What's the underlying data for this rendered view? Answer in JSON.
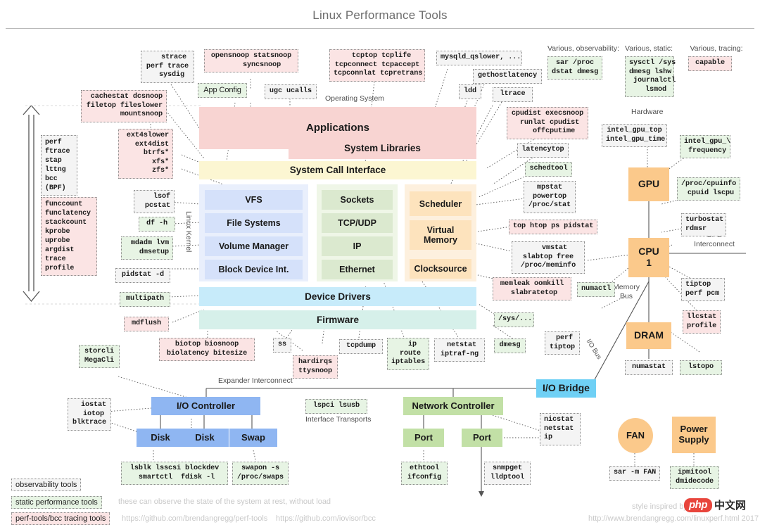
{
  "header": {
    "title": "Linux Performance Tools"
  },
  "section_labels": {
    "operating_system": "Operating System",
    "hardware": "Hardware",
    "linux_kernel": "Linux Kernel",
    "various_observability": "Various, observability:",
    "various_static": "Various, static:",
    "various_tracing": "Various, tracing:",
    "cpu_interconnect": "CPU\nInterconnect",
    "memory_bus": "Memory\nBus",
    "io_bus": "I/O Bus",
    "expander_interconnect": "Expander Interconnect",
    "interface_transports": "Interface Transports"
  },
  "stack": {
    "applications": "Applications",
    "system_libraries": "System Libraries",
    "system_call_interface": "System Call Interface",
    "device_drivers": "Device Drivers",
    "firmware": "Firmware",
    "file_column": [
      "VFS",
      "File Systems",
      "Volume Manager",
      "Block Device Int."
    ],
    "net_column": [
      "Sockets",
      "TCP/UDP",
      "IP",
      "Ethernet"
    ],
    "sched_column": [
      "Scheduler",
      "Virtual\nMemory",
      "Clocksource"
    ]
  },
  "hardware": {
    "gpu": "GPU",
    "cpu": "CPU\n1",
    "dram": "DRAM",
    "io_bridge": "I/O Bridge",
    "io_controller": "I/O Controller",
    "disk1": "Disk",
    "disk2": "Disk",
    "swap": "Swap",
    "network_controller": "Network Controller",
    "port1": "Port",
    "port2": "Port",
    "fan": "FAN",
    "power_supply": "Power\nSupply"
  },
  "tools": {
    "strace": "   strace\nperf trace\n  sysdig",
    "opensnoop": "opensnoop statsnoop\n     syncsnoop",
    "tcptop": "  tcptop tcplife\ntcpconnect tcpaccept\ntcpconnlat tcpretrans",
    "mysqld": "mysqld_qslower, ...",
    "gethostlatency": "gethostlatency",
    "ldd": "ldd",
    "ltrace": "ltrace",
    "app_config": "App Config",
    "ugc_ucalls": "ugc ucalls",
    "cachestat": "cachestat dcsnoop\nfiletop fileslower\n       mountsnoop",
    "ext4slower": "ext4slower\n  ext4dist\n    btrfs*\n      xfs*\n      zfs*",
    "perf_ftrace": "perf\nftrace\nstap\nlttng\nbcc\n(BPF)",
    "funccount": "funccount\nfunclatency\nstackcount\nkprobe\nuprobe\nargdist\ntrace\nprofile",
    "lsof": "  lsof\npcstat",
    "df": "df -h",
    "mdadm": "mdadm lvm\n  dmsetup",
    "pidstat_d": "pidstat -d",
    "multipath": "multipath",
    "mdflush": "mdflush",
    "sar_proc": "sar /proc\ndstat dmesg",
    "sysctl": "sysctl /sys\ndmesg lshw\n journalctl\n   lsmod",
    "capable": "capable",
    "cpudist": "cpudist execsnoop\n runlat cpudist\n   offcputime",
    "latencytop": "latencytop",
    "schedtool": "schedtool",
    "mpstat": "mpstat\npowertop\n/proc/stat",
    "top_htop": "top htop ps pidstat",
    "vmstat": "   vmstat\nslabtop free\n/proc/meminfo",
    "memleak": "memleak oomkill\n slabratetop",
    "numactl": "numactl",
    "sys_dir": "/sys/...",
    "dmesg": "dmesg",
    "perf_tiptop": " perf\ntiptop",
    "intel_gpu_top": "intel_gpu_top\nintel_gpu_time",
    "intel_gpu_freq": "intel_gpu_\\\n frequency",
    "proc_cpuinfo": "/proc/cpuinfo\n cpuid lscpu",
    "turbostat": "turbostat\nrdmsr",
    "tiptop": "tiptop\nperf pcm",
    "llcstat": "llcstat\nprofile",
    "numastat": "numastat",
    "lstopo": "lstopo",
    "biotop": "biotop biosnoop\nbiolatency bitesize",
    "storcli": "storcli\nMegaCli",
    "iostat": "  iostat\n  iotop\nblktrace",
    "ss": "ss",
    "hardirqs": "hardirqs\nttysnoop",
    "tcpdump": "tcpdump",
    "ip_route": "  ip\n route\niptables",
    "netstat": " netstat\niptraf-ng",
    "lspci": "lspci lsusb",
    "nicstat": "nicstat\nnetstat\nip",
    "lsblk": "lsblk lsscsi blockdev\n smartctl  fdisk -l",
    "swapon": "swapon -s\n/proc/swaps",
    "ethtool": "ethtool\nifconfig",
    "snmpget": "snmpget\nlldptool",
    "sar_fan": "sar -m FAN",
    "ipmitool": "ipmitool\ndmidecode"
  },
  "legend": {
    "observability": "observability tools",
    "static": "static performance tools",
    "tracing": "perf-tools/bcc tracing tools",
    "note_static": "these can observe the state of the system at rest, without load",
    "link_perf_tools": "https://github.com/brendangregg/perf-tools",
    "link_bcc": "https://github.com/iovisor/bcc",
    "style_credit": "style inspired by re",
    "source_url": "http://www.brendangregg.com/linuxperf.html 2017"
  },
  "watermark": {
    "php": "php",
    "cn": "中文网"
  },
  "colors": {
    "observability_bg": "#f4f4f4",
    "static_bg": "#e7f4e4",
    "tracing_bg": "#fbe4e4",
    "applications": "#f8d4d2",
    "syscall": "#fcf6d2",
    "filesystem": "#d5e1fa",
    "network": "#dbe9cf",
    "scheduler": "#fde3bd",
    "device_drivers": "#c7ebfa",
    "firmware": "#d6f0ea",
    "hardware": "#fbc98b",
    "io_bridge": "#6fd0f5"
  }
}
